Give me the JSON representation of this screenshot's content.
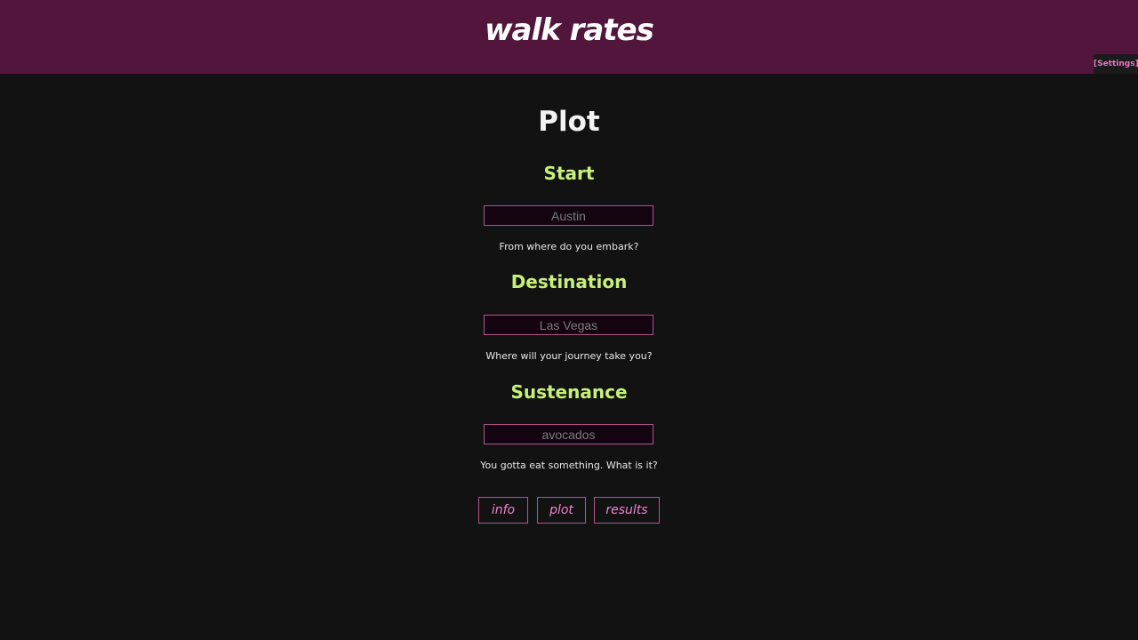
{
  "header": {
    "logo": "walk rates",
    "settings_label": "[Settings]",
    "brand_color": "#52163d"
  },
  "main": {
    "title": "Plot",
    "sections": [
      {
        "label": "Start",
        "placeholder": "Austin",
        "value": "",
        "hint": "From where do you embark?"
      },
      {
        "label": "Destination",
        "placeholder": "Las Vegas",
        "value": "",
        "hint": "Where will your journey take you?"
      },
      {
        "label": "Sustenance",
        "placeholder": "avocados",
        "value": "",
        "hint": "You gotta eat something. What is it?"
      }
    ],
    "buttons": {
      "info": "info",
      "plot": "plot",
      "results": "results"
    }
  },
  "colors": {
    "background": "#121212",
    "heading_accent": "#c7f07a",
    "border_accent": "#b0558e",
    "button_text": "#ee86cc"
  }
}
